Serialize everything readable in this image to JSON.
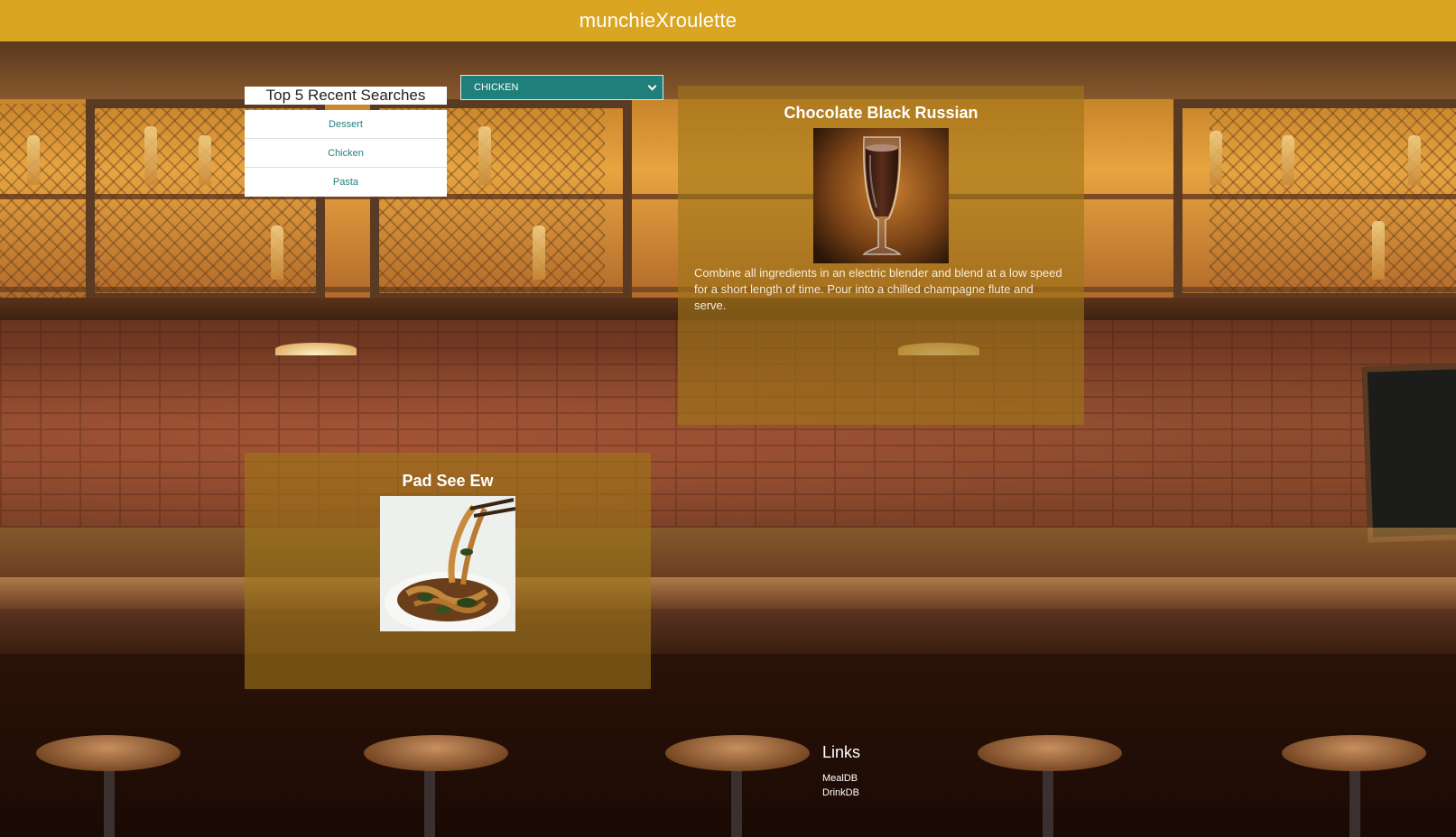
{
  "header": {
    "title": "munchieXroulette"
  },
  "recent_searches": {
    "title": "Top 5 Recent Searches",
    "items": [
      "Dessert",
      "Chicken",
      "Pasta"
    ]
  },
  "category_select": {
    "value": "CHICKEN"
  },
  "drink": {
    "title": "Chocolate Black Russian",
    "instructions": "Combine all ingredients in an electric blender and blend at a low speed for a short length of time. Pour into a chilled champagne flute and serve."
  },
  "meal": {
    "title": "Pad See Ew"
  },
  "footer": {
    "links_title": "Links",
    "links": [
      "MealDB",
      "DrinkDB"
    ]
  },
  "colors": {
    "header": "#daa520",
    "select": "#1f7f7a",
    "card_overlay": "rgba(160,118,24,0.62)",
    "recent_item_text": "#268080"
  }
}
